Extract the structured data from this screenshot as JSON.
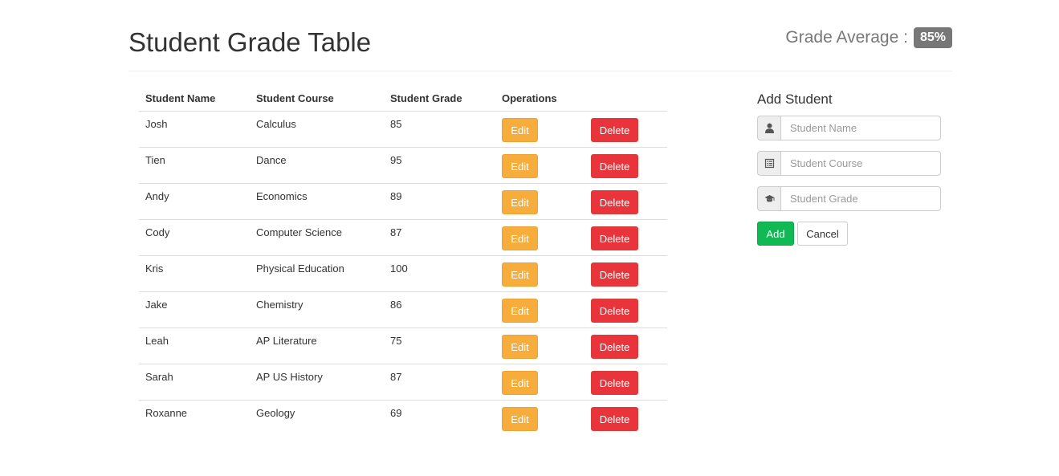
{
  "header": {
    "title": "Student Grade Table",
    "average_label": "Grade Average :",
    "average_value": "85%"
  },
  "table": {
    "columns": [
      "Student Name",
      "Student Course",
      "Student Grade",
      "Operations"
    ],
    "edit_label": "Edit",
    "delete_label": "Delete",
    "rows": [
      {
        "name": "Josh",
        "course": "Calculus",
        "grade": "85"
      },
      {
        "name": "Tien",
        "course": "Dance",
        "grade": "95"
      },
      {
        "name": "Andy",
        "course": "Economics",
        "grade": "89"
      },
      {
        "name": "Cody",
        "course": "Computer Science",
        "grade": "87"
      },
      {
        "name": "Kris",
        "course": "Physical Education",
        "grade": "100"
      },
      {
        "name": "Jake",
        "course": "Chemistry",
        "grade": "86"
      },
      {
        "name": "Leah",
        "course": "AP Literature",
        "grade": "75"
      },
      {
        "name": "Sarah",
        "course": "AP US History",
        "grade": "87"
      },
      {
        "name": "Roxanne",
        "course": "Geology",
        "grade": "69"
      }
    ]
  },
  "form": {
    "title": "Add Student",
    "name_placeholder": "Student Name",
    "course_placeholder": "Student Course",
    "grade_placeholder": "Student Grade",
    "name_icon": "user-icon",
    "course_icon": "list-alt-icon",
    "grade_icon": "education-icon",
    "add_label": "Add",
    "cancel_label": "Cancel"
  },
  "colors": {
    "edit": "#f7ad3b",
    "delete": "#e8343a",
    "add": "#10b954",
    "badge": "#777777"
  }
}
